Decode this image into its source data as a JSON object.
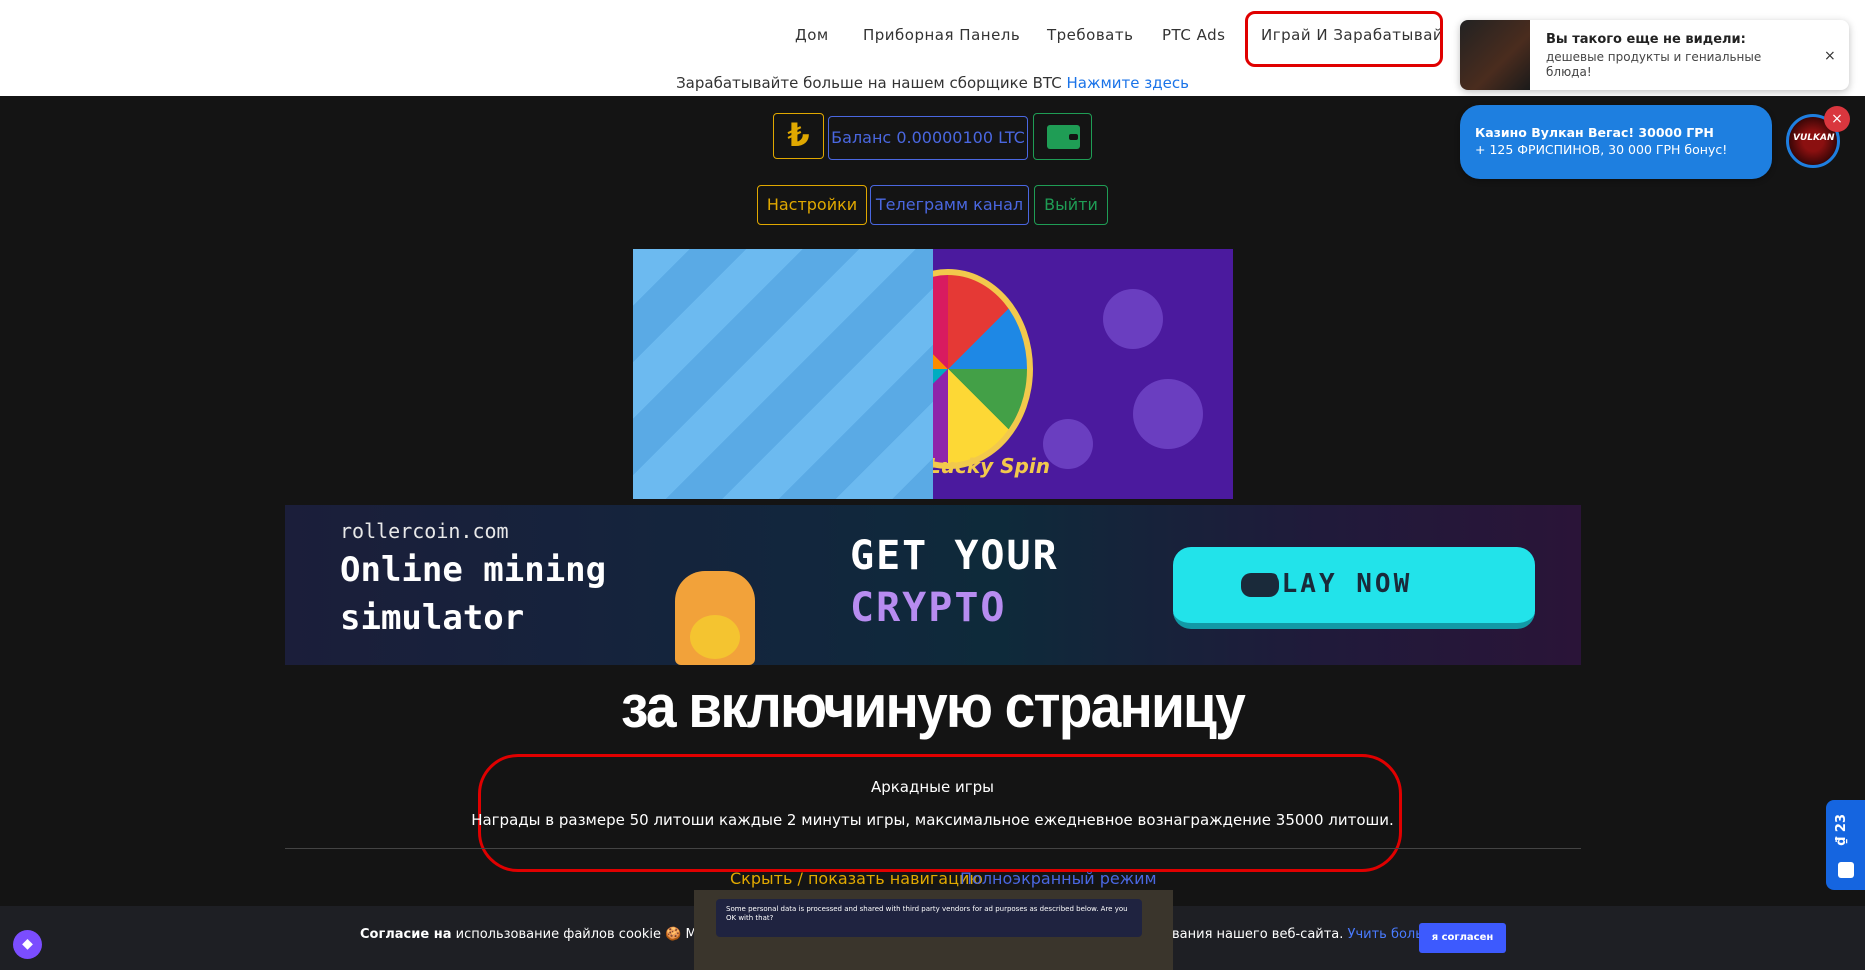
{
  "nav": {
    "items": [
      "Дом",
      "Приборная Панель",
      "Требовать",
      "PTC Ads",
      "Играй И Зарабатывай"
    ],
    "promo_text": "Зарабатывайте больше на нашем сборщике BTC",
    "promo_link": "Нажмите здесь"
  },
  "notification": {
    "title": "Вы такого еще не видели:",
    "body": "дешевые продукты и гениальные блюда!",
    "close": "×"
  },
  "casino_ad": {
    "title": "Казино Вулкан Вегас! 30000 ГРН",
    "subtitle": "+ 125 ФРИСПИНОВ, 30 000 ГРН бонус!",
    "avatar_label": "VULKAN",
    "close": "×"
  },
  "balance": {
    "currency_symbol": "₺",
    "label": "Баланс 0.00000100 LTC",
    "wallet_icon": "wallet-icon"
  },
  "actions": {
    "settings": "Настройки",
    "telegram": "Телеграмм канал",
    "logout": "Выйти"
  },
  "ads": {
    "lucky_spin": "Lucky Spin",
    "banner_site": "rollercoin.com",
    "banner_line1": "Online mining",
    "banner_line2": "simulator",
    "banner_get": "GET YOUR",
    "banner_crypto": "CRYPTO",
    "banner_play": "PLAY NOW"
  },
  "overlay_heading": "за включиную страницу",
  "game": {
    "title": "Аркадные игры",
    "description": "Награды в размере 50 литоши каждые 2 минуты игры, максимальное ежедневное вознаграждение 35000 литоши.",
    "toggle_nav": "Скрыть / показать навигацию",
    "fullscreen": "Полноэкранный режим"
  },
  "cookie": {
    "text_bold": "Согласие на",
    "text": "использование файлов cookie 🍪 Мы испо",
    "text_tail": "вания нашего веб-сайта.",
    "learn_more": "Учить больше",
    "accept": "я согласен",
    "consent_notice": "Some personal data is processed and shared with third party vendors for ad purposes as described below. Are you OK with that?"
  },
  "side_tab": {
    "label": "₫ 23"
  },
  "colors": {
    "accent_yellow": "#e0a800",
    "accent_blue": "#4a67e0",
    "accent_green": "#1f9d55",
    "highlight_red": "#e00000"
  }
}
